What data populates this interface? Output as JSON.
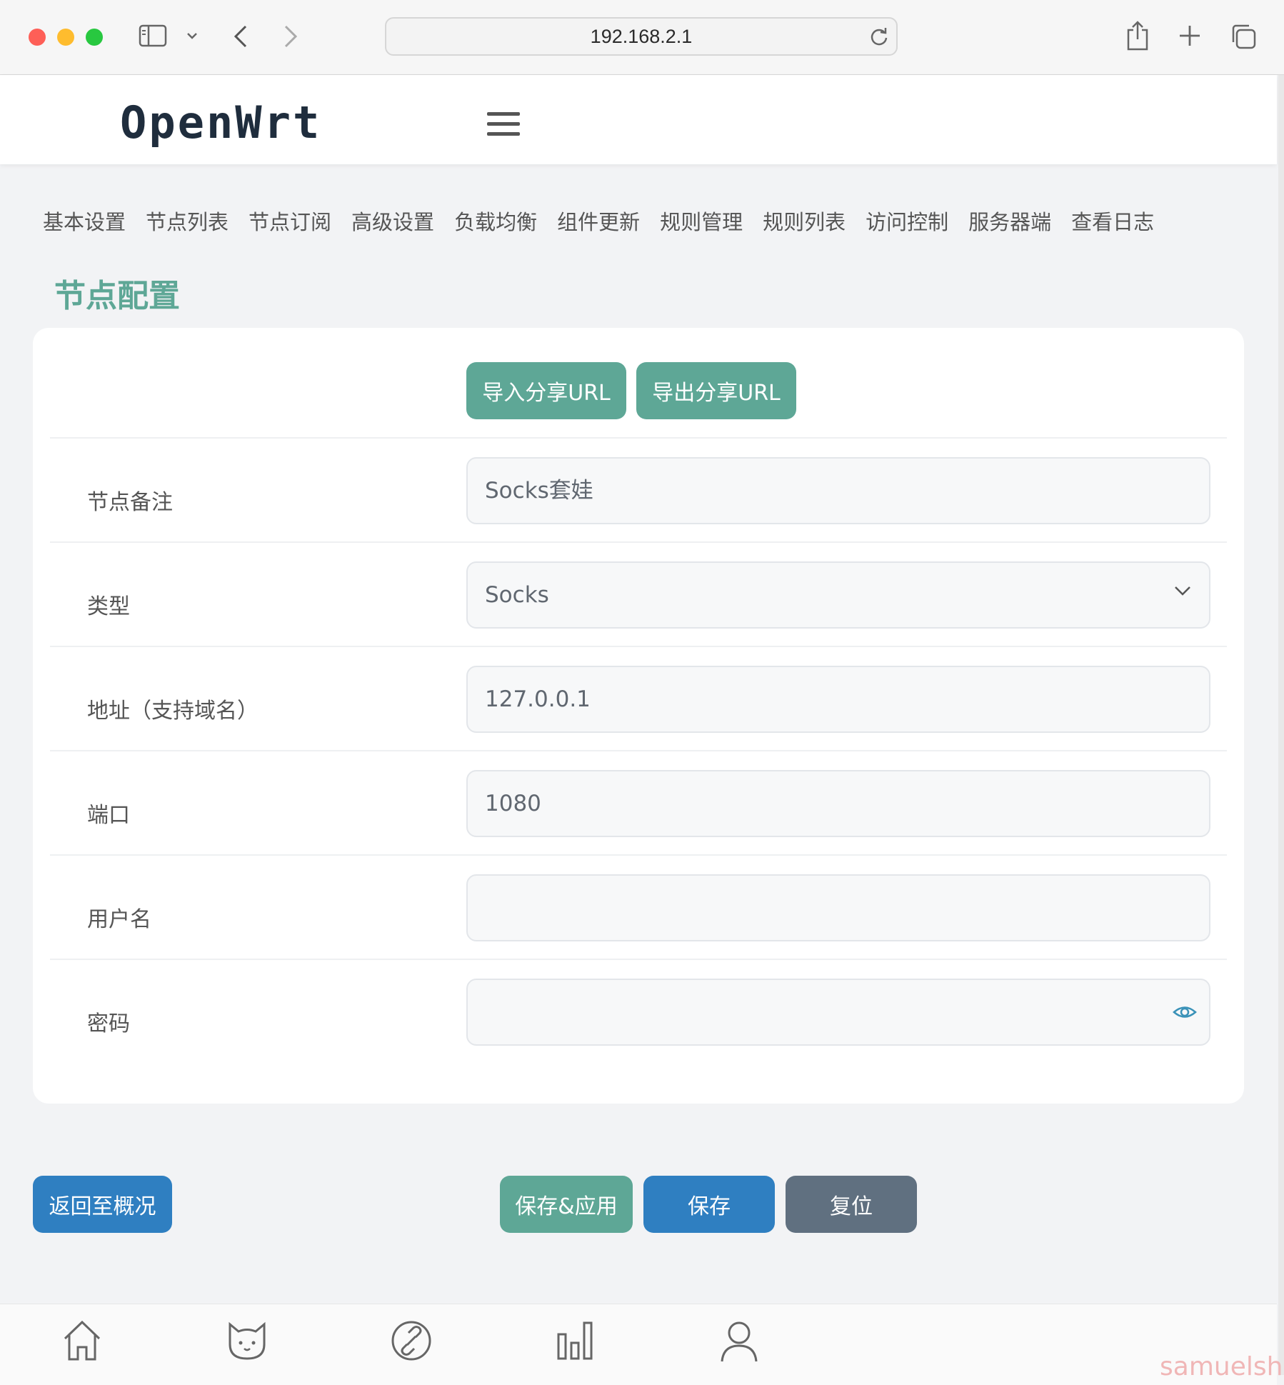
{
  "browser": {
    "url": "192.168.2.1"
  },
  "header": {
    "brand": "OpenWrt"
  },
  "tabs": [
    {
      "label": "基本设置"
    },
    {
      "label": "节点列表"
    },
    {
      "label": "节点订阅"
    },
    {
      "label": "高级设置"
    },
    {
      "label": "负载均衡"
    },
    {
      "label": "组件更新"
    },
    {
      "label": "规则管理"
    },
    {
      "label": "规则列表"
    },
    {
      "label": "访问控制"
    },
    {
      "label": "服务器端"
    },
    {
      "label": "查看日志"
    }
  ],
  "page": {
    "title": "节点配置"
  },
  "share": {
    "import_label": "导入分享URL",
    "export_label": "导出分享URL"
  },
  "form": {
    "remark": {
      "label": "节点备注",
      "value": "Socks套娃"
    },
    "type": {
      "label": "类型",
      "value": "Socks"
    },
    "address": {
      "label": "地址（支持域名）",
      "value": "127.0.0.1"
    },
    "port": {
      "label": "端口",
      "value": "1080"
    },
    "username": {
      "label": "用户名",
      "value": ""
    },
    "password": {
      "label": "密码",
      "value": ""
    }
  },
  "actions": {
    "back_label": "返回至概况",
    "save_apply_label": "保存&应用",
    "save_label": "保存",
    "reset_label": "复位"
  },
  "bottom_nav": {
    "icons": [
      "home-icon",
      "cat-icon",
      "link-icon",
      "bar-chart-icon",
      "user-icon"
    ]
  },
  "watermark": "samuelsh",
  "colors": {
    "accent_teal": "#5ea796",
    "primary_blue": "#2f7fc1",
    "reset_slate": "#607080"
  }
}
